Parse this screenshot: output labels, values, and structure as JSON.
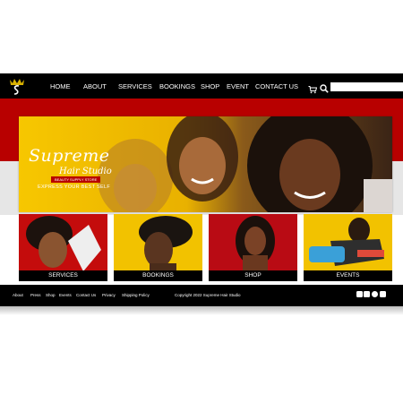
{
  "header": {
    "nav": [
      "HOME",
      "ABOUT",
      "SERVICES",
      "BOOKINGS",
      "SHOP",
      "EVENT",
      "CONTACT US"
    ],
    "search_placeholder": ""
  },
  "hero": {
    "brand_name": "Supreme",
    "brand_sub": "Hair Studio",
    "brand_badge": "BEAUTY SUPPLY STORE",
    "tagline": "EXPRESS YOUR BEST SELF"
  },
  "tiles": [
    {
      "label": "SERVICES"
    },
    {
      "label": "BOOKINGS"
    },
    {
      "label": "SHOP"
    },
    {
      "label": "EVENTS"
    }
  ],
  "footer": {
    "links": [
      "About",
      "Press",
      "Shop",
      "Events",
      "Contact Us",
      "Privacy",
      "Shipping Policy"
    ],
    "copyright": "Copyright 2022 Supreme Hair Studio",
    "social_icons": [
      "facebook-icon",
      "instagram-icon",
      "pinterest-icon",
      "youtube-icon"
    ]
  },
  "colors": {
    "brand_red": "#b80000",
    "brand_yellow": "#f2c200",
    "bar_black": "#000000"
  }
}
